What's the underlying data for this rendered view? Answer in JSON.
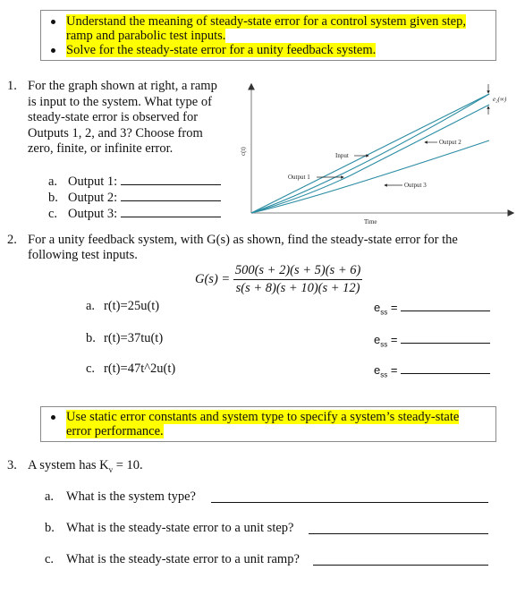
{
  "objectives_1": [
    {
      "lines": [
        "Understand the meaning of steady-state error for a control system given step,",
        "ramp and parabolic test inputs."
      ]
    },
    {
      "lines": [
        "Solve for the steady-state error for a unity feedback system."
      ]
    }
  ],
  "q1": {
    "number": "1.",
    "text_lines": [
      "For the graph shown at right, a ramp",
      "is input to the system. What type of",
      "steady-state error is observed for",
      "Outputs 1, 2, and 3?  Choose from",
      "zero, finite, or infinite error."
    ],
    "items": [
      {
        "letter": "a.",
        "label": "Output 1:"
      },
      {
        "letter": "b.",
        "label": "Output 2:"
      },
      {
        "letter": "c.",
        "label": "Output 3:"
      }
    ],
    "graph": {
      "ylabel": "c(t)",
      "xlabel": "Time",
      "labels": {
        "input": "Input",
        "output1": "Output 1",
        "output2": "Output 2",
        "output3": "Output 3",
        "error": "e₂(∞)"
      },
      "line_color": "#2a8ca3",
      "axis_color": "#999999"
    }
  },
  "q2": {
    "number": "2.",
    "text_lines": [
      "For a unity feedback system, with G(s) as shown, find the steady-state error for the",
      "following test inputs."
    ],
    "gs_lhs": "G(s) =",
    "gs_num": "500(s + 2)(s + 5)(s + 6)",
    "gs_den": "s(s + 8)(s + 10)(s + 12)",
    "items": [
      {
        "letter": "a.",
        "input": "r(t)=25u(t)",
        "answer_label": "e",
        "answer_sub": "ss",
        "eq": "="
      },
      {
        "letter": "b.",
        "input": "r(t)=37tu(t)",
        "answer_label": "e",
        "answer_sub": "ss",
        "eq": "="
      },
      {
        "letter": "c.",
        "input": "r(t)=47t^2u(t)",
        "answer_label": "e",
        "answer_sub": "ss",
        "eq": "="
      }
    ]
  },
  "objectives_2": [
    {
      "lines": [
        "Use static error constants and system type to specify a system’s steady-state",
        "error performance."
      ]
    }
  ],
  "q3": {
    "number": "3.",
    "text_pre": "A system has K",
    "text_sub": "v",
    "text_post": " = 10.",
    "items": [
      {
        "letter": "a.",
        "label": "What is the system type?"
      },
      {
        "letter": "b.",
        "label": "What is the steady-state error to a unit step?"
      },
      {
        "letter": "c.",
        "label": "What is the steady-state error to a unit ramp?"
      }
    ]
  },
  "colors": {
    "highlight": "#ffff00",
    "box_border": "#8a8a8a"
  }
}
